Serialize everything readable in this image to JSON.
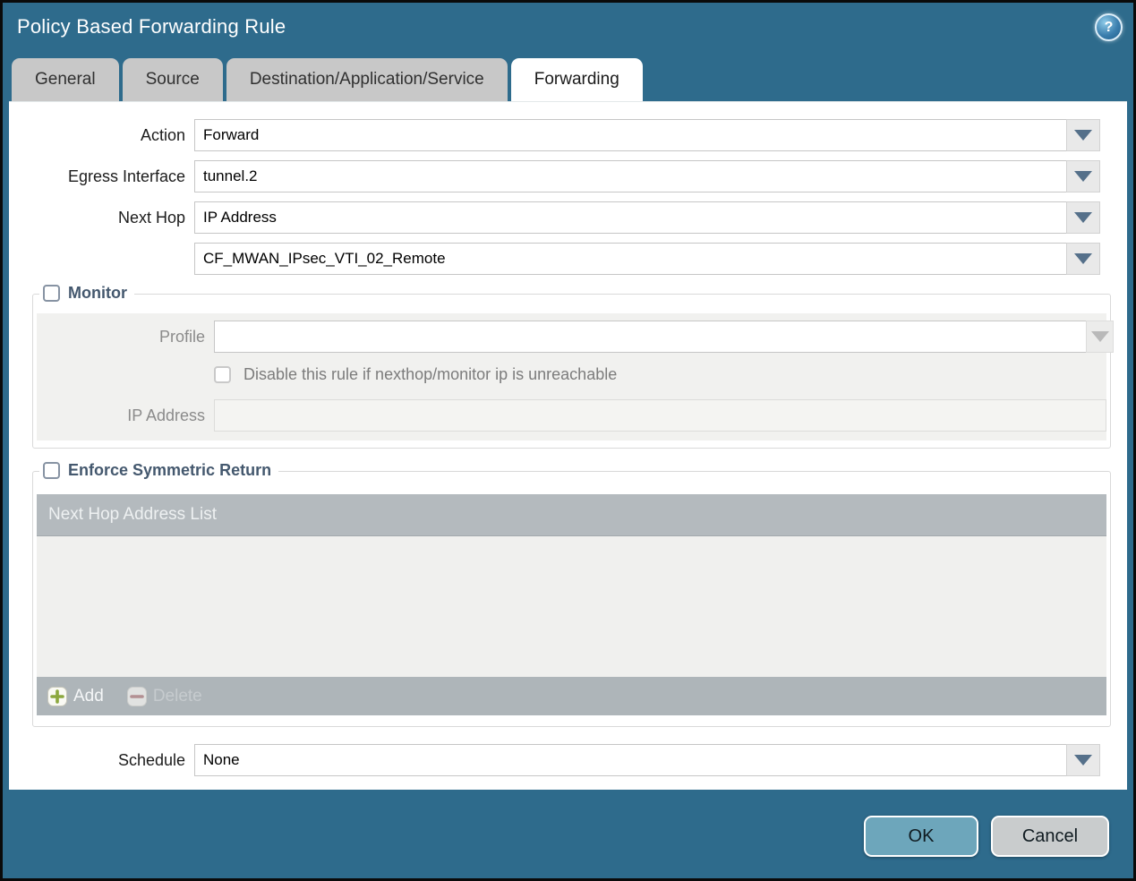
{
  "window": {
    "title": "Policy Based Forwarding Rule",
    "help_glyph": "?"
  },
  "tabs": [
    {
      "label": "General",
      "active": false
    },
    {
      "label": "Source",
      "active": false
    },
    {
      "label": "Destination/Application/Service",
      "active": false
    },
    {
      "label": "Forwarding",
      "active": true
    }
  ],
  "form": {
    "action": {
      "label": "Action",
      "value": "Forward"
    },
    "egress_interface": {
      "label": "Egress Interface",
      "value": "tunnel.2"
    },
    "next_hop": {
      "label": "Next Hop",
      "value": "IP Address"
    },
    "next_hop_address": {
      "value": "CF_MWAN_IPsec_VTI_02_Remote"
    },
    "schedule": {
      "label": "Schedule",
      "value": "None"
    }
  },
  "monitor": {
    "legend": "Monitor",
    "checked": false,
    "profile": {
      "label": "Profile",
      "value": ""
    },
    "disable_rule": {
      "label": "Disable this rule if nexthop/monitor ip is unreachable",
      "checked": false
    },
    "ip_address": {
      "label": "IP Address",
      "value": ""
    }
  },
  "symmetric_return": {
    "legend": "Enforce Symmetric Return",
    "checked": false,
    "table": {
      "header": "Next Hop Address List",
      "rows": []
    },
    "add_label": "Add",
    "delete_label": "Delete"
  },
  "footer": {
    "ok": "OK",
    "cancel": "Cancel"
  },
  "colors": {
    "frame_teal": "#2e6b8c",
    "active_tab": "#ffffff",
    "inactive_tab": "#c8c8c8",
    "ok_button": "#6da6bb",
    "cancel_button": "#c9cccd",
    "disabled_field_cream": "#f3ecd8",
    "panel_gray": "#f1f1ef",
    "table_header_gray": "#b4babe",
    "table_footer_gray": "#aeb5b9",
    "legend_text": "#44586e",
    "add_plus_green": "#8ca83e",
    "delete_minus_red": "#b5888a"
  }
}
